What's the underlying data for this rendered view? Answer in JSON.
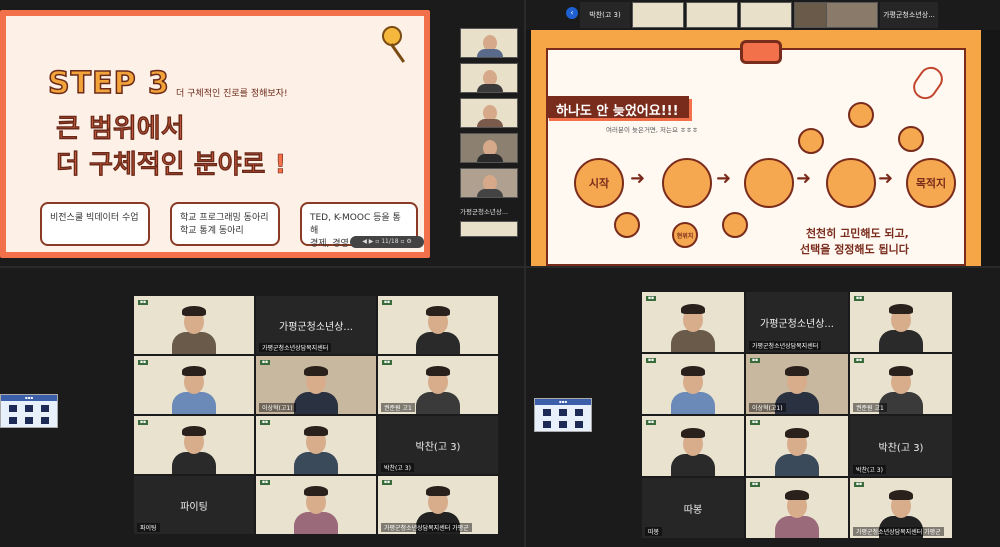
{
  "slide1": {
    "step": "STEP 3",
    "subtitle": "더 구체적인 진로를 정해보자!",
    "title_line1": "큰 범위에서",
    "title_line2": "더 구체적인 분야로 !",
    "box1": "비전스쿨 빅데이터 수업",
    "box2": "학교 프로그래밍 동아리\n학교 통계 동아리",
    "box3": "TED, K-MOOC 등을 통해\n경제, 경영 강의 듣기",
    "controls": "◀ ▶  ▫ 11/18 ▫ ⚙"
  },
  "q1_thumbs": {
    "names": [
      "",
      "",
      "",
      "",
      "",
      ""
    ],
    "label": "가평군청소년상..."
  },
  "slide2": {
    "header": "하나도 안 늦었어요!!!",
    "note": "여러분이 늦은거면, 저는요 ㅎㅎㅎ",
    "start": "시작",
    "goal": "목적지",
    "now": "현위치",
    "foot1": "천천히 고민해도 되고,",
    "foot2": "선택을 정정해도 됩니다",
    "top_name": "박찬(고 3)",
    "top_label": "가평군청소년상..."
  },
  "gallery_left": {
    "header_tile": "가평군청소년상...",
    "pachan": "박찬(고 3)",
    "fighting": "파이팅",
    "labels": [
      "",
      "가평군청소년상담복지센터",
      "",
      "",
      "이상혁(고1)",
      "권준원 고1",
      "",
      "",
      "박찬(고 3)",
      "파이팅",
      "",
      "가평군청소년상담복지센터 가평군"
    ]
  },
  "gallery_right": {
    "header_tile": "가평군청소년상...",
    "pachan": "박찬(고 3)",
    "ddabong": "따봉",
    "labels": [
      "",
      "가평군청소년상담복지센터",
      "",
      "",
      "이상혁(고1)",
      "권준원 고1",
      "",
      "",
      "박찬(고 3)",
      "따봉",
      "",
      "가평군청소년상담복지센터 가평군"
    ]
  },
  "colors": {
    "orange": "#f2704a",
    "brown": "#7a2c1c",
    "cream": "#fff9f2",
    "amber": "#f6a646"
  }
}
